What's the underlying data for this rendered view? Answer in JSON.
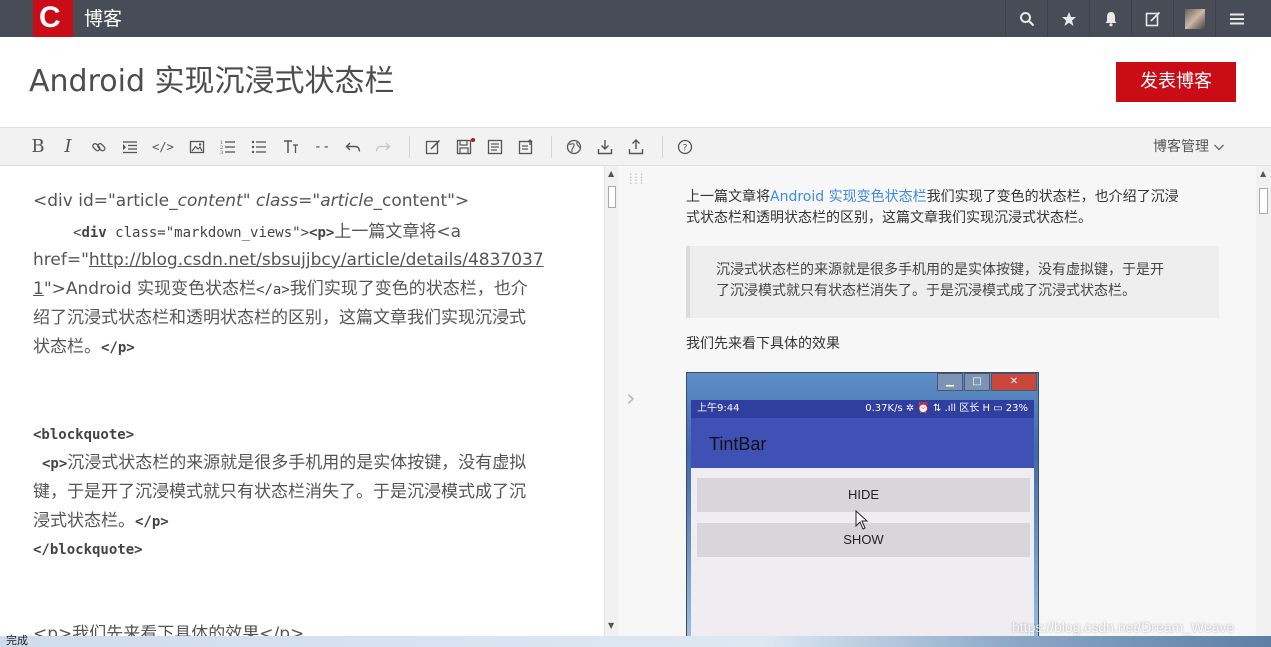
{
  "header": {
    "logo_letter": "C",
    "brand": "博客",
    "icons": [
      "search-icon",
      "star-icon",
      "bell-icon",
      "edit-icon",
      "avatar",
      "menu-icon"
    ]
  },
  "title": "Android 实现沉浸式状态栏",
  "publish_label": "发表博客",
  "toolbar": {
    "items": [
      "B",
      "I",
      "link-icon",
      "indent-icon",
      "</>",
      "image-icon",
      "ordered-list-icon",
      "unordered-list-icon",
      "heading-icon",
      "--",
      "undo-icon",
      "redo-icon",
      "draft-icon",
      "save-icon",
      "summary-icon",
      "import-icon",
      "web-icon",
      "download-icon",
      "upload-icon",
      "help-icon"
    ],
    "bold": "B",
    "italic": "I",
    "code": "</>",
    "hr": "--",
    "help": "?",
    "manage_label": "博客管理"
  },
  "editor": {
    "l1_a": "<div id=\"article",
    "l1_b": "_content\" class=\"article",
    "l1_c": "_content\">",
    "l2_tag_open": "<",
    "l2_div": "div",
    "l2_attr": " class=\"markdown_views\">",
    "l2_p": "<p>",
    "l2_text": "上一篇文章将<a",
    "l3_a": "href=\"",
    "l3_url": "http://blog.csdn.net/sbsujjbcy/article/details/4837037",
    "l4_url": "1",
    "l4_text": "\">Android 实现变色状态栏",
    "l4_close": "</a>",
    "l4_tail": "我们实现了变色的状态栏，也介",
    "l5": "绍了沉浸式状态栏和透明状态栏的区别，这篇文章我们实现沉浸式",
    "l6_text": "状态栏。",
    "l6_close": "</p>",
    "bq_open": "<blockquote>",
    "bq_p": "<p>",
    "bq_l1": "沉浸式状态栏的来源就是很多手机用的是实体按键，没有虚拟",
    "bq_l2": "键，于是开了沉浸模式就只有状态栏消失了。于是沉浸模式成了沉",
    "bq_l3": "浸式状态栏。",
    "bq_pclose": "</p>",
    "bq_close": "</blockquote>",
    "last_line": "<p>我们先来看下具体的效果</p>"
  },
  "preview": {
    "p1_a": "上一篇文章将",
    "p1_link": "Android 实现变色状态栏",
    "p1_b": "我们实现了变色的状态栏，也介绍了沉浸",
    "p1_c": "式状态栏和透明状态栏的区别，这篇文章我们实现沉浸式状态栏。",
    "quote_l1": "沉浸式状态栏的来源就是很多手机用的是实体按键，没有虚拟键，于是开",
    "quote_l2": "了沉浸模式就只有状态栏消失了。于是沉浸模式成了沉浸式状态栏。",
    "p2": "我们先来看下具体的效果",
    "phone": {
      "time": "上午9:44",
      "status_right": "0.37K/s ✲ ⏰ ⇅ .ıll 区长 H ▭ 23%",
      "app_title": "TintBar",
      "btn_hide": "HIDE",
      "btn_show": "SHOW",
      "win_min": "▁",
      "win_max": "□",
      "win_close": "✕"
    }
  },
  "watermark": "https://blog.csdn.net/Dream_Weave",
  "status_bar": "完成",
  "colors": {
    "brand_red": "#ca0c16",
    "topbar": "#474c57",
    "link": "#3d8ae0",
    "appbar": "#3f51b5"
  }
}
